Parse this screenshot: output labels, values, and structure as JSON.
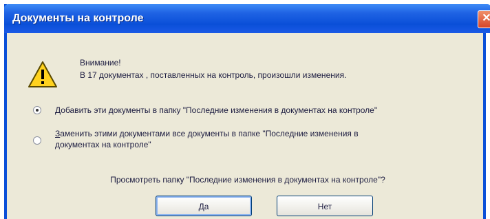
{
  "window": {
    "title": "Документы на контроле",
    "close_glyph": "✕"
  },
  "message": {
    "icon": "warning-icon",
    "heading": "Внимание!",
    "text": "В 17  документах , поставленных на контроль, произошли изменения."
  },
  "options": [
    {
      "label": "Добавить эти документы в папку \"Последние изменения в документах на контроле\"",
      "selected": true
    },
    {
      "label_line1": "Заменить этими документами все документы в папке \"Последние изменения в",
      "label_line2": "документах на контроле\"",
      "selected": false
    }
  ],
  "question": "Просмотреть папку \"Последние изменения в документах на контроле\"?",
  "buttons": {
    "yes": "Да",
    "no": "Нет"
  }
}
